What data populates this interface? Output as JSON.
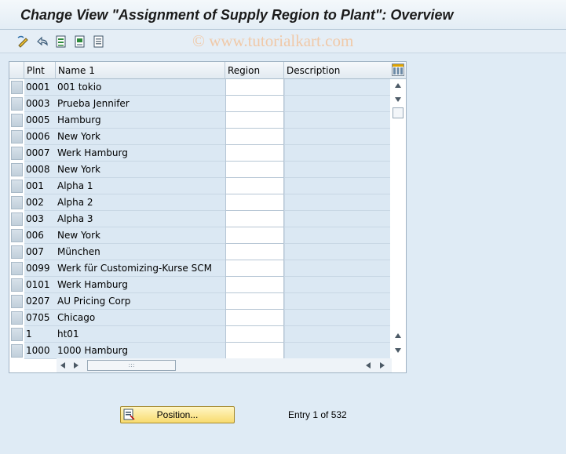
{
  "window": {
    "title": "Change View \"Assignment of Supply Region to Plant\": Overview"
  },
  "watermark": "© www.tutorialkart.com",
  "toolbar": {
    "icons": [
      "change-display-icon",
      "undo-icon",
      "select-all-icon",
      "select-block-icon",
      "deselect-all-icon"
    ]
  },
  "table": {
    "columns": [
      "Plnt",
      "Name 1",
      "Region",
      "Description"
    ],
    "rows": [
      {
        "plnt": "0001",
        "name": "001 tokio",
        "region": "",
        "description": ""
      },
      {
        "plnt": "0003",
        "name": "Prueba Jennifer",
        "region": "",
        "description": ""
      },
      {
        "plnt": "0005",
        "name": "Hamburg",
        "region": "",
        "description": ""
      },
      {
        "plnt": "0006",
        "name": "New York",
        "region": "",
        "description": ""
      },
      {
        "plnt": "0007",
        "name": "Werk Hamburg",
        "region": "",
        "description": ""
      },
      {
        "plnt": "0008",
        "name": "New York",
        "region": "",
        "description": ""
      },
      {
        "plnt": "001",
        "name": "Alpha 1",
        "region": "",
        "description": ""
      },
      {
        "plnt": "002",
        "name": "Alpha 2",
        "region": "",
        "description": ""
      },
      {
        "plnt": "003",
        "name": "Alpha 3",
        "region": "",
        "description": ""
      },
      {
        "plnt": "006",
        "name": "New York",
        "region": "",
        "description": ""
      },
      {
        "plnt": "007",
        "name": "München",
        "region": "",
        "description": ""
      },
      {
        "plnt": "0099",
        "name": "Werk für Customizing-Kurse SCM",
        "region": "",
        "description": ""
      },
      {
        "plnt": "0101",
        "name": "Werk Hamburg",
        "region": "",
        "description": ""
      },
      {
        "plnt": "0207",
        "name": "AU Pricing Corp",
        "region": "",
        "description": ""
      },
      {
        "plnt": "0705",
        "name": "Chicago",
        "region": "",
        "description": ""
      },
      {
        "plnt": "1",
        "name": "ht01",
        "region": "",
        "description": ""
      },
      {
        "plnt": "1000",
        "name": "1000 Hamburg",
        "region": "",
        "description": ""
      }
    ]
  },
  "footer": {
    "position_label": "Position...",
    "entry_text": "Entry 1 of 532"
  },
  "colors": {
    "background": "#dfebf5",
    "readonly_cell": "#dbe8f3",
    "button_yellow": "#f8db6f"
  }
}
